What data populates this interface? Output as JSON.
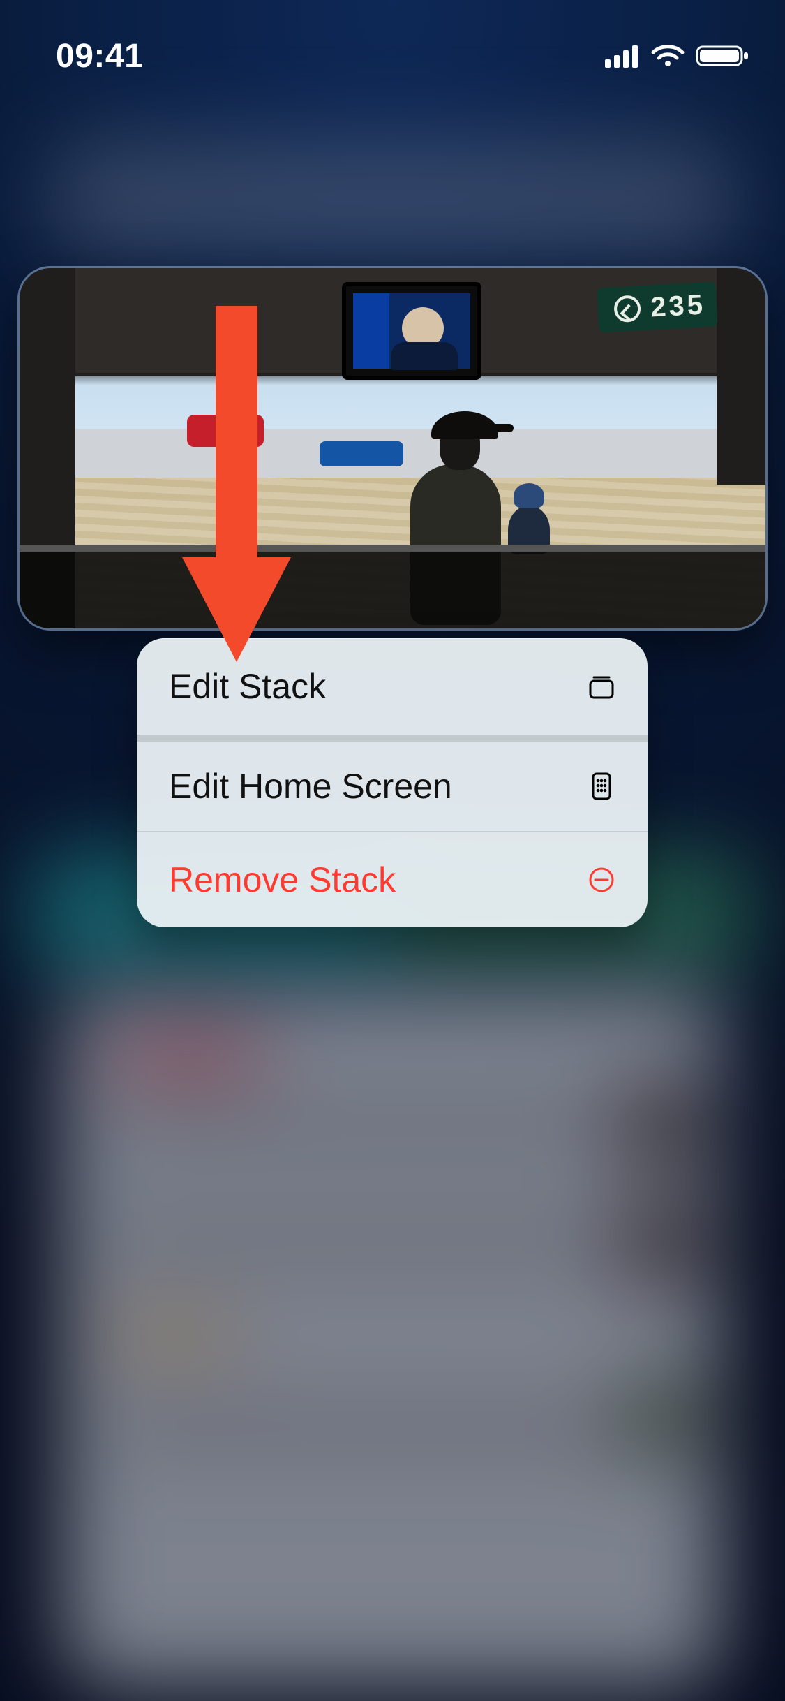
{
  "status_bar": {
    "time": "09:41",
    "icons": {
      "cellular": "cellular-icon",
      "wifi": "wifi-icon",
      "battery": "battery-icon"
    }
  },
  "widget": {
    "sign_number": "235"
  },
  "menu": {
    "items": [
      {
        "label": "Edit Stack",
        "icon": "stack-icon",
        "destructive": false
      },
      {
        "label": "Edit Home Screen",
        "icon": "apps-grid-icon",
        "destructive": false
      },
      {
        "label": "Remove Stack",
        "icon": "minus-circle-icon",
        "destructive": true
      }
    ]
  },
  "colors": {
    "destructive": "#ff3b30",
    "arrow": "#f24a2a"
  }
}
